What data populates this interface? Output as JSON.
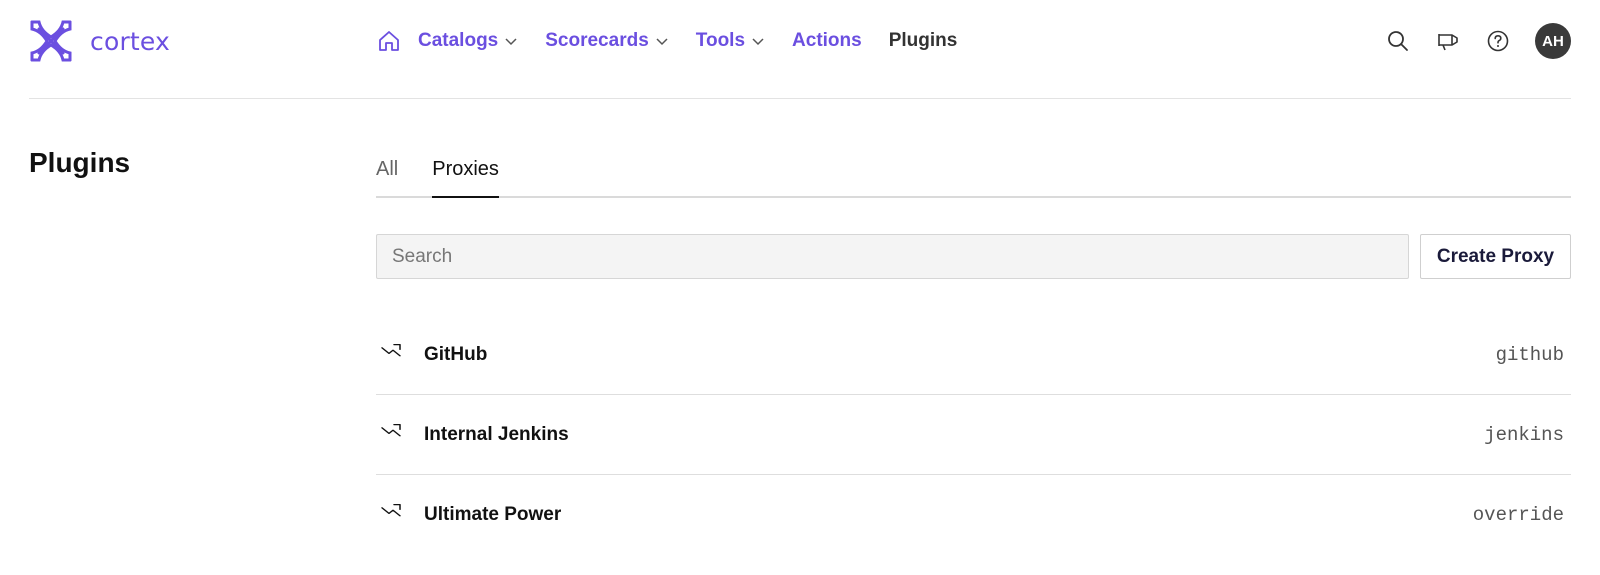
{
  "brand": {
    "name": "cortex",
    "color": "#6b4fe0"
  },
  "nav": {
    "home_icon": "home-icon",
    "items": [
      {
        "label": "Catalogs",
        "has_dropdown": true
      },
      {
        "label": "Scorecards",
        "has_dropdown": true
      },
      {
        "label": "Tools",
        "has_dropdown": true
      },
      {
        "label": "Actions",
        "has_dropdown": false
      },
      {
        "label": "Plugins",
        "has_dropdown": false,
        "active": true
      }
    ]
  },
  "header_actions": {
    "icons": [
      "search-icon",
      "megaphone-icon",
      "help-icon"
    ],
    "avatar_initials": "AH"
  },
  "page": {
    "title": "Plugins"
  },
  "tabs": [
    {
      "label": "All",
      "active": false
    },
    {
      "label": "Proxies",
      "active": true
    }
  ],
  "search": {
    "placeholder": "Search",
    "value": ""
  },
  "create_button": {
    "label": "Create Proxy"
  },
  "proxies": [
    {
      "name": "GitHub",
      "tag": "github"
    },
    {
      "name": "Internal Jenkins",
      "tag": "jenkins"
    },
    {
      "name": "Ultimate Power",
      "tag": "override"
    }
  ]
}
